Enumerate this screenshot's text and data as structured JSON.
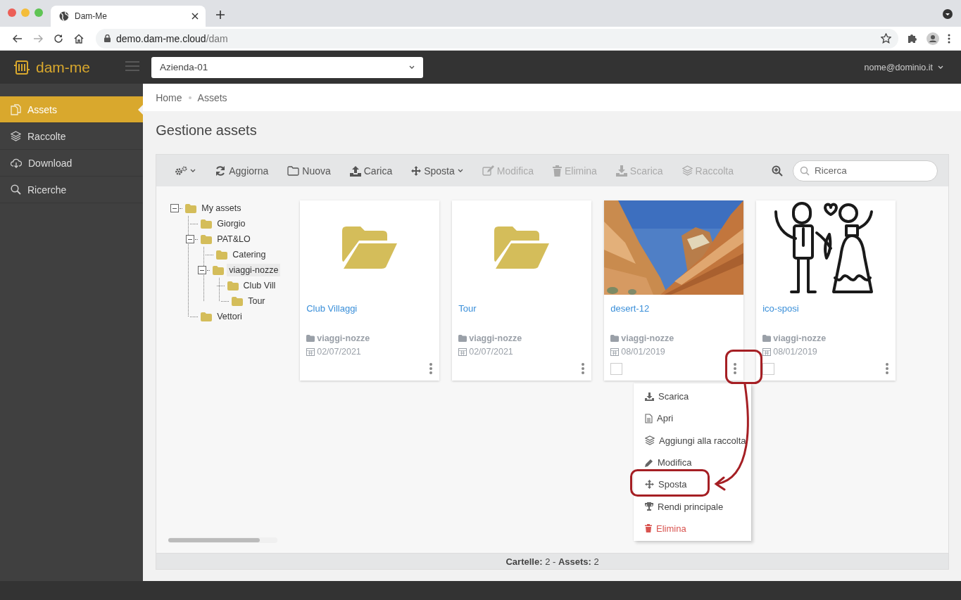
{
  "browser": {
    "tab_title": "Dam-Me",
    "url_host": "demo.dam-me.cloud",
    "url_path": "/dam"
  },
  "header": {
    "logo": "dam-me",
    "company": "Azienda-01",
    "user": "nome@dominio.it"
  },
  "sidebar": {
    "items": [
      {
        "label": "Assets",
        "selected": true
      },
      {
        "label": "Raccolte",
        "selected": false
      },
      {
        "label": "Download",
        "selected": false
      },
      {
        "label": "Ricerche",
        "selected": false
      }
    ]
  },
  "breadcrumb": [
    "Home",
    "Assets"
  ],
  "page_title": "Gestione assets",
  "toolbar": {
    "actions": [
      {
        "dropdown": true,
        "disabled": false
      },
      {
        "label": "Aggiorna",
        "dropdown": false,
        "disabled": false
      },
      {
        "label": "Nuova",
        "dropdown": false,
        "disabled": false
      },
      {
        "label": "Carica",
        "dropdown": false,
        "disabled": false
      },
      {
        "label": "Sposta",
        "dropdown": true,
        "disabled": false
      },
      {
        "label": "Modifica",
        "dropdown": false,
        "disabled": true
      },
      {
        "label": "Elimina",
        "dropdown": false,
        "disabled": true
      },
      {
        "label": "Scarica",
        "dropdown": false,
        "disabled": true
      },
      {
        "label": "Raccolta",
        "dropdown": false,
        "disabled": true
      }
    ],
    "search": {
      "placeholder": "Ricerca"
    }
  },
  "tree": [
    {
      "label": "My assets",
      "expanded": true,
      "selected": false,
      "children": [
        {
          "label": "Giorgio",
          "selected": false
        },
        {
          "label": "PAT&LO",
          "expanded": true,
          "selected": false,
          "children": [
            {
              "label": "Catering",
              "selected": false
            },
            {
              "label": "viaggi-nozze",
              "expanded": true,
              "selected": true,
              "children": [
                {
                  "label": "Club Vill",
                  "selected": false
                },
                {
                  "label": "Tour",
                  "selected": false
                }
              ]
            }
          ]
        },
        {
          "label": "Vettori",
          "selected": false
        }
      ]
    }
  ],
  "cards": [
    {
      "kind": "folder",
      "title": "Club Villaggi",
      "folder": "viaggi-nozze",
      "date": "02/07/2021"
    },
    {
      "kind": "folder",
      "title": "Tour",
      "folder": "viaggi-nozze",
      "date": "02/07/2021"
    },
    {
      "kind": "picture",
      "title": "desert-12",
      "folder": "viaggi-nozze",
      "date": "08/01/2019",
      "checked": false
    },
    {
      "kind": "drawing",
      "title": "ico-sposi",
      "folder": "viaggi-nozze",
      "date": "08/01/2019",
      "checked": false
    }
  ],
  "context_menu": {
    "items": [
      {
        "label": "Scarica",
        "danger": false
      },
      {
        "label": "Apri",
        "danger": false
      },
      {
        "label": "Aggiungi alla raccolta",
        "danger": false
      },
      {
        "label": "Modifica",
        "danger": false
      },
      {
        "label": "Sposta",
        "danger": false
      },
      {
        "label": "Rendi principale",
        "danger": false
      },
      {
        "label": "Elimina",
        "danger": true
      }
    ]
  },
  "status_bar": "**Cartelle:** 2 - **Assets:** 2"
}
